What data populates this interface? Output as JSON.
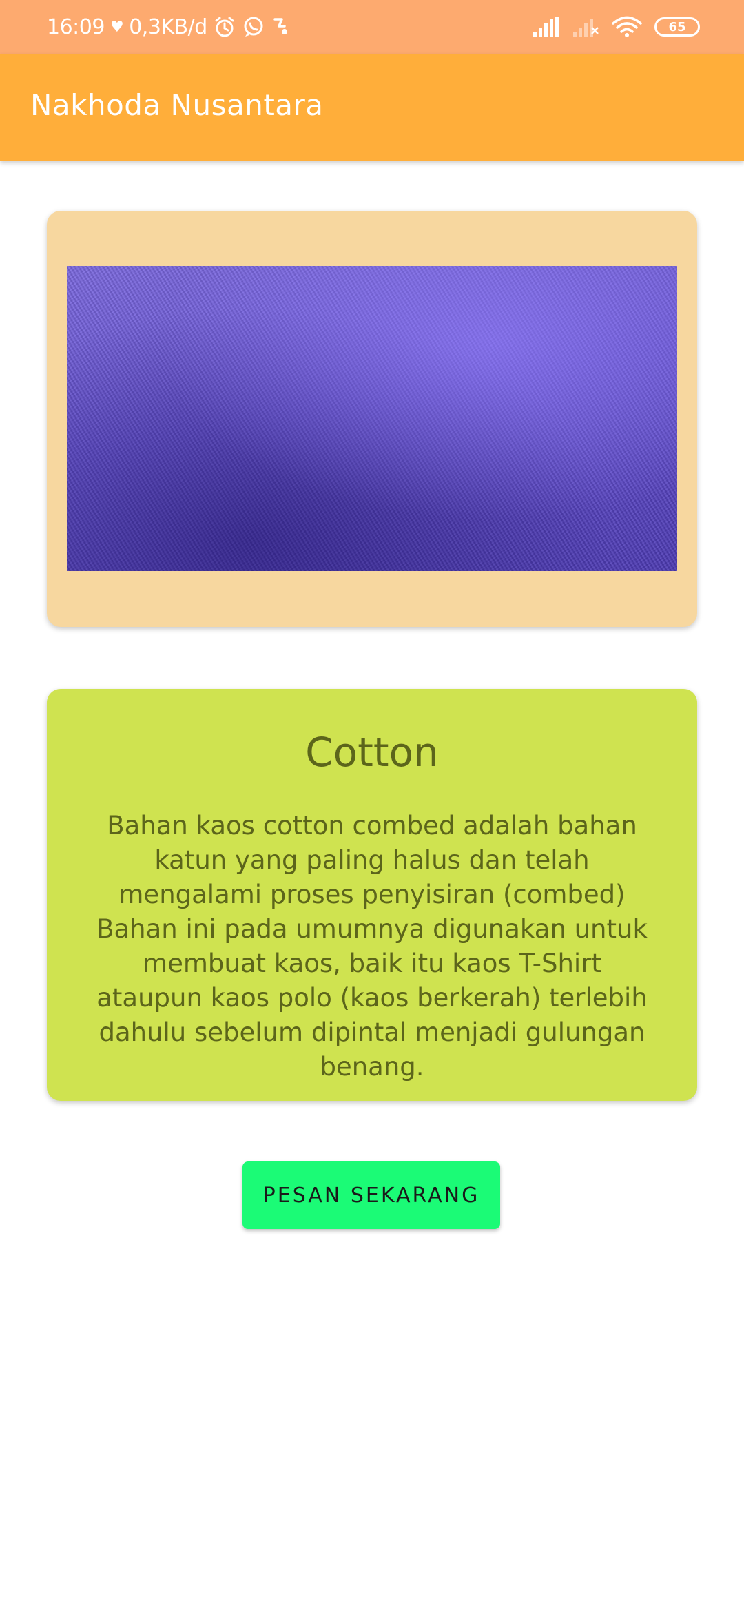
{
  "status_bar": {
    "time": "16:09",
    "heart": "♥",
    "network_speed": "0,3KB/d",
    "battery": "65",
    "icons": [
      "heart-icon",
      "alarm-icon",
      "whatsapp-icon",
      "notification-icon",
      "signal-icon",
      "signal-no-service-icon",
      "wifi-icon",
      "battery-icon"
    ]
  },
  "app_bar": {
    "title": "Nakhoda Nusantara"
  },
  "product_image": {
    "description": "purple cotton fabric"
  },
  "description_card": {
    "title": "Cotton",
    "body": "Bahan kaos cotton combed adalah bahan katun yang paling halus dan telah mengalami proses penyisiran (combed) Bahan ini pada umumnya digunakan untuk membuat kaos, baik itu kaos T-Shirt ataupun kaos polo (kaos berkerah) terlebih dahulu sebelum dipintal menjadi gulungan benang."
  },
  "order_button": {
    "label": "PESAN SEKARANG"
  },
  "colors": {
    "status_bar": "#FDAA6F",
    "app_bar": "#FFAE3A",
    "image_card": "#F7D79F",
    "desc_card": "#CFE350",
    "desc_text": "#5C651B",
    "button": "#1BFB76"
  }
}
